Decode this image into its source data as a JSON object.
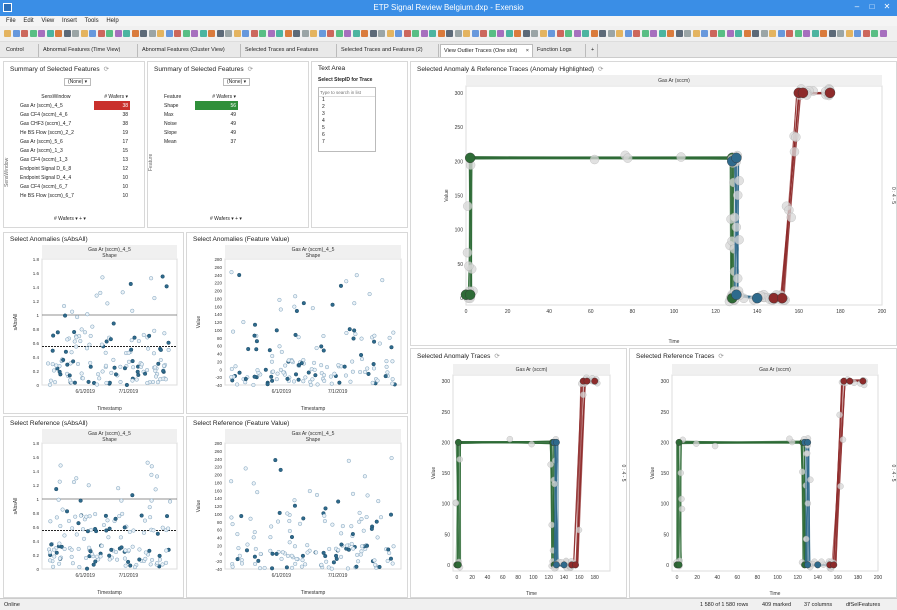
{
  "window": {
    "title": "ETP Signal Review Belgium.dxp - Exensio"
  },
  "menu": [
    "File",
    "Edit",
    "View",
    "Insert",
    "Tools",
    "Help"
  ],
  "tabs": [
    {
      "label": "Control"
    },
    {
      "label": "Abnormal Features (Time View)"
    },
    {
      "label": "Abnormal Features (Cluster View)"
    },
    {
      "label": "Selected Traces and Features"
    },
    {
      "label": "Selected Traces and Features (2)"
    },
    {
      "label": "View Outlier Traces (One slot)",
      "close": "×"
    },
    {
      "label": "Function Logs"
    }
  ],
  "colors": {
    "green": "#2e6b36",
    "teal": "#2e6a8c",
    "red": "#8e2b2b",
    "ring": "#c6c6c6",
    "hl_red": "#c9302c",
    "hl_green": "#2f8f3a",
    "title": "#3a8ee6"
  },
  "summary1": {
    "title": "Summary of Selected Features",
    "filter": "(None)",
    "col1": "SensWindow",
    "col2": "# Wafers",
    "side": "SensWindow",
    "rows": [
      {
        "name": "Gas Ar (sccm)_4_5",
        "value": "38"
      },
      {
        "name": "Gas CF4 (sccm)_4_6",
        "value": "38"
      },
      {
        "name": "Gas CHF3 (sccm)_4_7",
        "value": "38"
      },
      {
        "name": "He BS Flow (sccm)_2_2",
        "value": "19"
      },
      {
        "name": "Gas Ar (sccm)_5_6",
        "value": "17"
      },
      {
        "name": "Gas Ar (sccm)_1_3",
        "value": "15"
      },
      {
        "name": "Gas CF4 (sccm)_1_3",
        "value": "13"
      },
      {
        "name": "Endpoint Signal D_6_8",
        "value": "12"
      },
      {
        "name": "Endpoint Signal D_4_4",
        "value": "10"
      },
      {
        "name": "Gas CF4 (sccm)_6_7",
        "value": "10"
      },
      {
        "name": "He BS Flow (sccm)_6_7",
        "value": "10"
      }
    ],
    "footer": "# Wafers"
  },
  "summary2": {
    "title": "Summary of Selected Features",
    "filter": "(None)",
    "col1": "Feature",
    "col2": "# Wafers",
    "side": "Feature",
    "rows": [
      {
        "name": "Shape",
        "value": "56"
      },
      {
        "name": "Max",
        "value": "49"
      },
      {
        "name": "Noise",
        "value": "49"
      },
      {
        "name": "Slope",
        "value": "49"
      },
      {
        "name": "Mean",
        "value": "37"
      }
    ],
    "footer": "# Wafers"
  },
  "textarea": {
    "title": "Text Area",
    "label": "Select StepID for Trace",
    "placeholder": "Type to search in list",
    "items": [
      "1",
      "2",
      "3",
      "4",
      "5",
      "6",
      "7"
    ]
  },
  "charts": {
    "main": {
      "title": "Selected Anomaly & Reference Traces (Anomaly Highlighted)",
      "header": "Gas Ar (sccm)",
      "x_label": "Time",
      "y_label": "Value",
      "right_label": "0 : 4 - 5"
    },
    "anom": {
      "title": "Selected Anomaly Traces",
      "header": "Gas Ar (sccm)",
      "x_label": "Time",
      "y_label": "Value",
      "right_label": "0 : 4 - 5"
    },
    "ref": {
      "title": "Selected Reference Traces",
      "header": "Gas Ar (sccm)",
      "x_label": "Time",
      "y_label": "Value",
      "right_label": "0 : 4 - 5"
    },
    "sa_abs": {
      "title": "Select Anomalies (sAbsAll)",
      "header": "Gas Ar (sccm)_4_5",
      "sub": "Shape",
      "x_label": "Timestamp",
      "y_label": "sAbsAll"
    },
    "sa_val": {
      "title": "Select Anomalies (Feature Value)",
      "header": "Gas Ar (sccm)_4_5",
      "sub": "Shape",
      "x_label": "Timestamp",
      "y_label": "Value"
    },
    "sr_abs": {
      "title": "Select Reference (sAbsAll)",
      "header": "Gas Ar (sccm)_4_5",
      "sub": "Shape",
      "x_label": "Timestamp",
      "y_label": "sAbsAll"
    },
    "sr_val": {
      "title": "Select Reference (Feature Value)",
      "header": "Gas Ar (sccm)_4_5",
      "sub": "Shape",
      "x_label": "Timestamp",
      "y_label": "Value"
    }
  },
  "chart_data": [
    {
      "id": "main",
      "type": "line",
      "x_ticks": [
        "0",
        "20",
        "40",
        "60",
        "80",
        "100",
        "120",
        "140",
        "160",
        "180",
        "200"
      ],
      "xlim": [
        0,
        200
      ],
      "ylim": [
        -10,
        310
      ],
      "y_ticks": [
        "0",
        "50",
        "100",
        "150",
        "200",
        "250",
        "300"
      ],
      "series": [
        {
          "color": "#2e6b36",
          "x": [
            0,
            2,
            2,
            128,
            128
          ],
          "y": [
            5,
            5,
            205,
            205,
            0
          ]
        },
        {
          "color": "#2e6a8c",
          "x": [
            128,
            130,
            130,
            140,
            148
          ],
          "y": [
            200,
            205,
            5,
            0,
            0
          ]
        },
        {
          "color": "#8e2b2b",
          "x": [
            148,
            152,
            160,
            162,
            175
          ],
          "y": [
            0,
            0,
            300,
            300,
            300
          ]
        }
      ]
    },
    {
      "id": "anom",
      "type": "line",
      "x_ticks": [
        "0",
        "20",
        "40",
        "60",
        "80",
        "100",
        "120",
        "140",
        "160",
        "180"
      ],
      "xlim": [
        -5,
        200
      ],
      "ylim": [
        -10,
        310
      ],
      "y_ticks": [
        "0",
        "50",
        "100",
        "150",
        "200",
        "250",
        "300"
      ],
      "series": [
        {
          "color": "#2e6b36",
          "x": [
            0,
            2,
            2,
            125,
            127
          ],
          "y": [
            0,
            0,
            200,
            200,
            0
          ]
        },
        {
          "color": "#2e6a8c",
          "x": [
            127,
            130,
            130,
            140,
            150
          ],
          "y": [
            200,
            200,
            0,
            0,
            0
          ]
        },
        {
          "color": "#8e2b2b",
          "x": [
            150,
            155,
            165,
            170,
            180
          ],
          "y": [
            0,
            0,
            300,
            300,
            300
          ]
        }
      ]
    },
    {
      "id": "ref",
      "type": "line",
      "x_ticks": [
        "0",
        "20",
        "40",
        "60",
        "80",
        "100",
        "120",
        "140",
        "160",
        "180",
        "200"
      ],
      "xlim": [
        -5,
        200
      ],
      "ylim": [
        -10,
        310
      ],
      "y_ticks": [
        "0",
        "50",
        "100",
        "150",
        "200",
        "250",
        "300"
      ],
      "series": [
        {
          "color": "#2e6b36",
          "x": [
            0,
            2,
            2,
            125,
            127
          ],
          "y": [
            0,
            0,
            200,
            200,
            0
          ]
        },
        {
          "color": "#2e6a8c",
          "x": [
            127,
            130,
            130,
            140,
            152
          ],
          "y": [
            200,
            200,
            0,
            0,
            0
          ]
        },
        {
          "color": "#8e2b2b",
          "x": [
            152,
            156,
            166,
            172,
            185
          ],
          "y": [
            0,
            0,
            300,
            300,
            300
          ]
        }
      ]
    },
    {
      "id": "sa_abs",
      "type": "scatter",
      "x_ticks": [
        "6/1/2019",
        "7/1/2019"
      ],
      "y_ticks": [
        "0",
        "0.2",
        "0.4",
        "0.6",
        "0.8",
        "1",
        "1.2",
        "1.4",
        "1.6",
        "1.8"
      ],
      "ylim": [
        0,
        1.8
      ],
      "ref_lines": [
        1,
        0.55
      ],
      "seed": 3
    },
    {
      "id": "sa_val",
      "type": "scatter",
      "x_ticks": [
        "6/1/2019",
        "7/1/2019"
      ],
      "y_ticks": [
        "-40",
        "-20",
        "0",
        "20",
        "40",
        "60",
        "80",
        "100",
        "120",
        "140",
        "160",
        "180",
        "200",
        "220",
        "240",
        "260",
        "280"
      ],
      "ylim": [
        -40,
        280
      ],
      "ref_lines": [],
      "seed": 7
    },
    {
      "id": "sr_abs",
      "type": "scatter",
      "x_ticks": [
        "6/1/2019",
        "7/1/2019"
      ],
      "y_ticks": [
        "0",
        "0.2",
        "0.4",
        "0.6",
        "0.8",
        "1",
        "1.2",
        "1.4",
        "1.6",
        "1.8"
      ],
      "ylim": [
        0,
        1.8
      ],
      "ref_lines": [
        1,
        0.55
      ],
      "seed": 11
    },
    {
      "id": "sr_val",
      "type": "scatter",
      "x_ticks": [
        "6/1/2019",
        "7/1/2019"
      ],
      "y_ticks": [
        "-40",
        "-20",
        "0",
        "20",
        "40",
        "60",
        "80",
        "100",
        "120",
        "140",
        "160",
        "180",
        "200",
        "220",
        "240",
        "260",
        "280"
      ],
      "ylim": [
        -40,
        280
      ],
      "ref_lines": [],
      "seed": 13
    }
  ],
  "status": {
    "left": "Online",
    "rows": "1 580 of 1 580 rows",
    "marked": "409 marked",
    "cols": "37 columns",
    "table": "dfSelFeatures"
  }
}
